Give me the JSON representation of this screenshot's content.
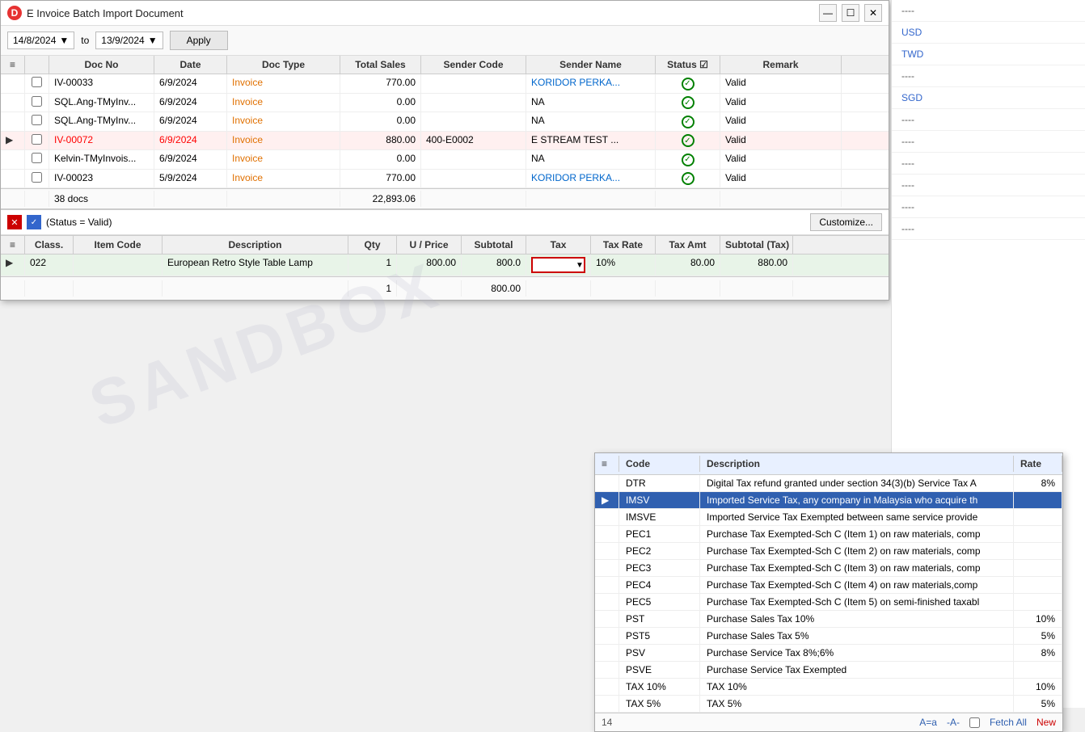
{
  "window": {
    "title": "E Invoice Batch Import Document",
    "icon": "D"
  },
  "toolbar": {
    "from_date": "14/8/2024",
    "to_label": "to",
    "to_date": "13/9/2024",
    "apply_label": "Apply"
  },
  "top_grid": {
    "columns": [
      "",
      "",
      "Doc No",
      "Date",
      "Doc Type",
      "Total Sales",
      "Sender Code",
      "Sender Name",
      "Status",
      "Remark"
    ],
    "rows": [
      {
        "arrow": "",
        "check": false,
        "doc_no": "IV-00033",
        "date": "6/9/2024",
        "doc_type": "Invoice",
        "total_sales": "770.00",
        "sender_code": "",
        "sender_name": "KORIDOR PERKA...",
        "status": "valid",
        "remark": "Valid",
        "highlight": false
      },
      {
        "arrow": "",
        "check": false,
        "doc_no": "SQL.Ang-TMyInv...",
        "date": "6/9/2024",
        "doc_type": "Invoice",
        "total_sales": "0.00",
        "sender_code": "",
        "sender_name": "NA",
        "status": "valid",
        "remark": "Valid",
        "highlight": false
      },
      {
        "arrow": "",
        "check": false,
        "doc_no": "SQL.Ang-TMyInv...",
        "date": "6/9/2024",
        "doc_type": "Invoice",
        "total_sales": "0.00",
        "sender_code": "",
        "sender_name": "NA",
        "status": "valid",
        "remark": "Valid",
        "highlight": false
      },
      {
        "arrow": "▶",
        "check": false,
        "doc_no": "IV-00072",
        "date": "6/9/2024",
        "doc_type": "Invoice",
        "total_sales": "880.00",
        "sender_code": "400-E0002",
        "sender_name": "E STREAM TEST ...",
        "status": "valid",
        "remark": "Valid",
        "highlight": true
      },
      {
        "arrow": "",
        "check": false,
        "doc_no": "Kelvin-TMyInvois...",
        "date": "6/9/2024",
        "doc_type": "Invoice",
        "total_sales": "0.00",
        "sender_code": "",
        "sender_name": "NA",
        "status": "valid",
        "remark": "Valid",
        "highlight": false
      },
      {
        "arrow": "",
        "check": false,
        "doc_no": "IV-00023",
        "date": "5/9/2024",
        "doc_type": "Invoice",
        "total_sales": "770.00",
        "sender_code": "",
        "sender_name": "KORIDOR PERKA...",
        "status": "valid",
        "remark": "Valid",
        "highlight": false
      }
    ],
    "footer": {
      "docs_count": "38 docs",
      "total": "22,893.06"
    }
  },
  "filter_bar": {
    "status_label": "(Status = Valid)",
    "customize_label": "Customize..."
  },
  "detail_grid": {
    "columns": [
      "",
      "Class.",
      "Item Code",
      "Description",
      "Qty",
      "U / Price",
      "Subtotal",
      "Tax",
      "Tax Rate",
      "Tax Amt",
      "Subtotal (Tax)"
    ],
    "rows": [
      {
        "arrow": "▶",
        "class": "022",
        "item_code": "",
        "description": "European Retro Style Table Lamp",
        "qty": "1",
        "u_price": "800.00",
        "subtotal": "800.0",
        "tax": "",
        "tax_rate": "10%",
        "tax_amt": "80.00",
        "subtotal_tax": "880.00"
      }
    ],
    "footer": {
      "qty": "1",
      "subtotal": "800.00"
    }
  },
  "tax_dropdown": {
    "columns": [
      "",
      "Code",
      "Description",
      "Rate"
    ],
    "rows": [
      {
        "arrow": "",
        "code": "DTR",
        "description": "Digital Tax refund granted under section 34(3)(b) Service Tax A",
        "rate": "8%",
        "selected": false
      },
      {
        "arrow": "▶",
        "code": "IMSV",
        "description": "Imported Service Tax, any company in Malaysia who acquire th",
        "rate": "",
        "selected": true
      },
      {
        "arrow": "",
        "code": "IMSVE",
        "description": "Imported Service Tax Exempted between same service provide",
        "rate": "",
        "selected": false
      },
      {
        "arrow": "",
        "code": "PEC1",
        "description": "Purchase Tax Exempted-Sch C (Item 1) on raw materials, comp",
        "rate": "",
        "selected": false
      },
      {
        "arrow": "",
        "code": "PEC2",
        "description": "Purchase Tax Exempted-Sch C (Item 2) on raw materials, comp",
        "rate": "",
        "selected": false
      },
      {
        "arrow": "",
        "code": "PEC3",
        "description": "Purchase Tax Exempted-Sch C (Item 3) on raw materials, comp",
        "rate": "",
        "selected": false
      },
      {
        "arrow": "",
        "code": "PEC4",
        "description": "Purchase Tax Exempted-Sch C (Item 4) on raw materials,comp",
        "rate": "",
        "selected": false
      },
      {
        "arrow": "",
        "code": "PEC5",
        "description": "Purchase Tax Exempted-Sch C (Item 5) on semi-finished taxabl",
        "rate": "",
        "selected": false
      },
      {
        "arrow": "",
        "code": "PST",
        "description": "Purchase Sales Tax 10%",
        "rate": "10%",
        "selected": false
      },
      {
        "arrow": "",
        "code": "PST5",
        "description": "Purchase Sales Tax 5%",
        "rate": "5%",
        "selected": false
      },
      {
        "arrow": "",
        "code": "PSV",
        "description": "Purchase Service Tax 8%;6%",
        "rate": "8%",
        "selected": false
      },
      {
        "arrow": "",
        "code": "PSVE",
        "description": "Purchase Service Tax Exempted",
        "rate": "",
        "selected": false
      },
      {
        "arrow": "",
        "code": "TAX 10%",
        "description": "TAX 10%",
        "rate": "10%",
        "selected": false
      },
      {
        "arrow": "",
        "code": "TAX 5%",
        "description": "TAX 5%",
        "rate": "5%",
        "selected": false
      }
    ],
    "footer": {
      "count": "14",
      "a_eq_a": "A=a",
      "a_minus": "-A-",
      "fetch_all": "Fetch All",
      "new_label": "New"
    }
  },
  "right_sidebar": {
    "items": [
      {
        "text": "----",
        "type": "dash"
      },
      {
        "text": "USD",
        "type": "currency-usd"
      },
      {
        "text": "TWD",
        "type": "currency-twd"
      },
      {
        "text": "----",
        "type": "dash"
      },
      {
        "text": "SGD",
        "type": "currency-sgd"
      },
      {
        "text": "----",
        "type": "dash"
      },
      {
        "text": "----",
        "type": "dash"
      },
      {
        "text": "----",
        "type": "dash"
      },
      {
        "text": "----",
        "type": "dash"
      },
      {
        "text": "----",
        "type": "dash"
      },
      {
        "text": "----",
        "type": "dash"
      }
    ]
  },
  "colors": {
    "accent_blue": "#3060b0",
    "accent_green": "#00aa00",
    "accent_red": "#cc0000",
    "selected_row_bg": "#dde8f8",
    "invoice_orange": "#e07000"
  }
}
